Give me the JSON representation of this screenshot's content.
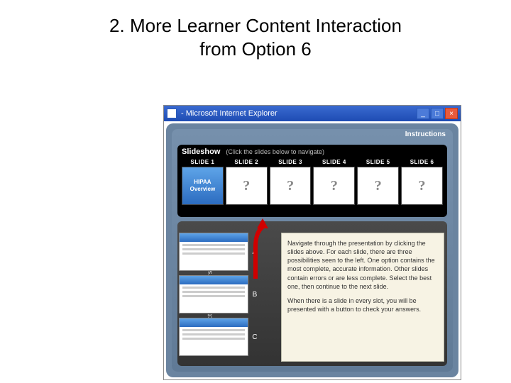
{
  "title_line1": "2. More Learner Content Interaction",
  "title_line2": "from  Option 6",
  "window": {
    "title": " - Microsoft Internet Explorer",
    "min": "_",
    "max": "□",
    "close": "×"
  },
  "app": {
    "instructions_link": "Instructions",
    "slideshow": {
      "title": "Slideshow",
      "hint": "(Click the slides below to navigate)",
      "slides": [
        {
          "label": "SLIDE 1",
          "active": true,
          "text": "HIPAA Overview"
        },
        {
          "label": "SLIDE 2",
          "active": false
        },
        {
          "label": "SLIDE 3",
          "active": false
        },
        {
          "label": "SLIDE 4",
          "active": false
        },
        {
          "label": "SLIDE 5",
          "active": false
        },
        {
          "label": "SLIDE 6",
          "active": false
        }
      ]
    },
    "options": {
      "vertical_label": "Select the best version",
      "items": [
        {
          "label": "A"
        },
        {
          "label": "B"
        },
        {
          "label": "C"
        }
      ]
    },
    "instructions": {
      "p1": "Navigate through the presentation by clicking the slides above. For each slide, there are three possibilities seen to the left. One option contains the most complete, accurate information. Other slides contain errors or are less complete. Select the best one, then continue to the next slide.",
      "p2": "When there is a slide in every slot, you will be presented with a button to check your answers."
    }
  }
}
